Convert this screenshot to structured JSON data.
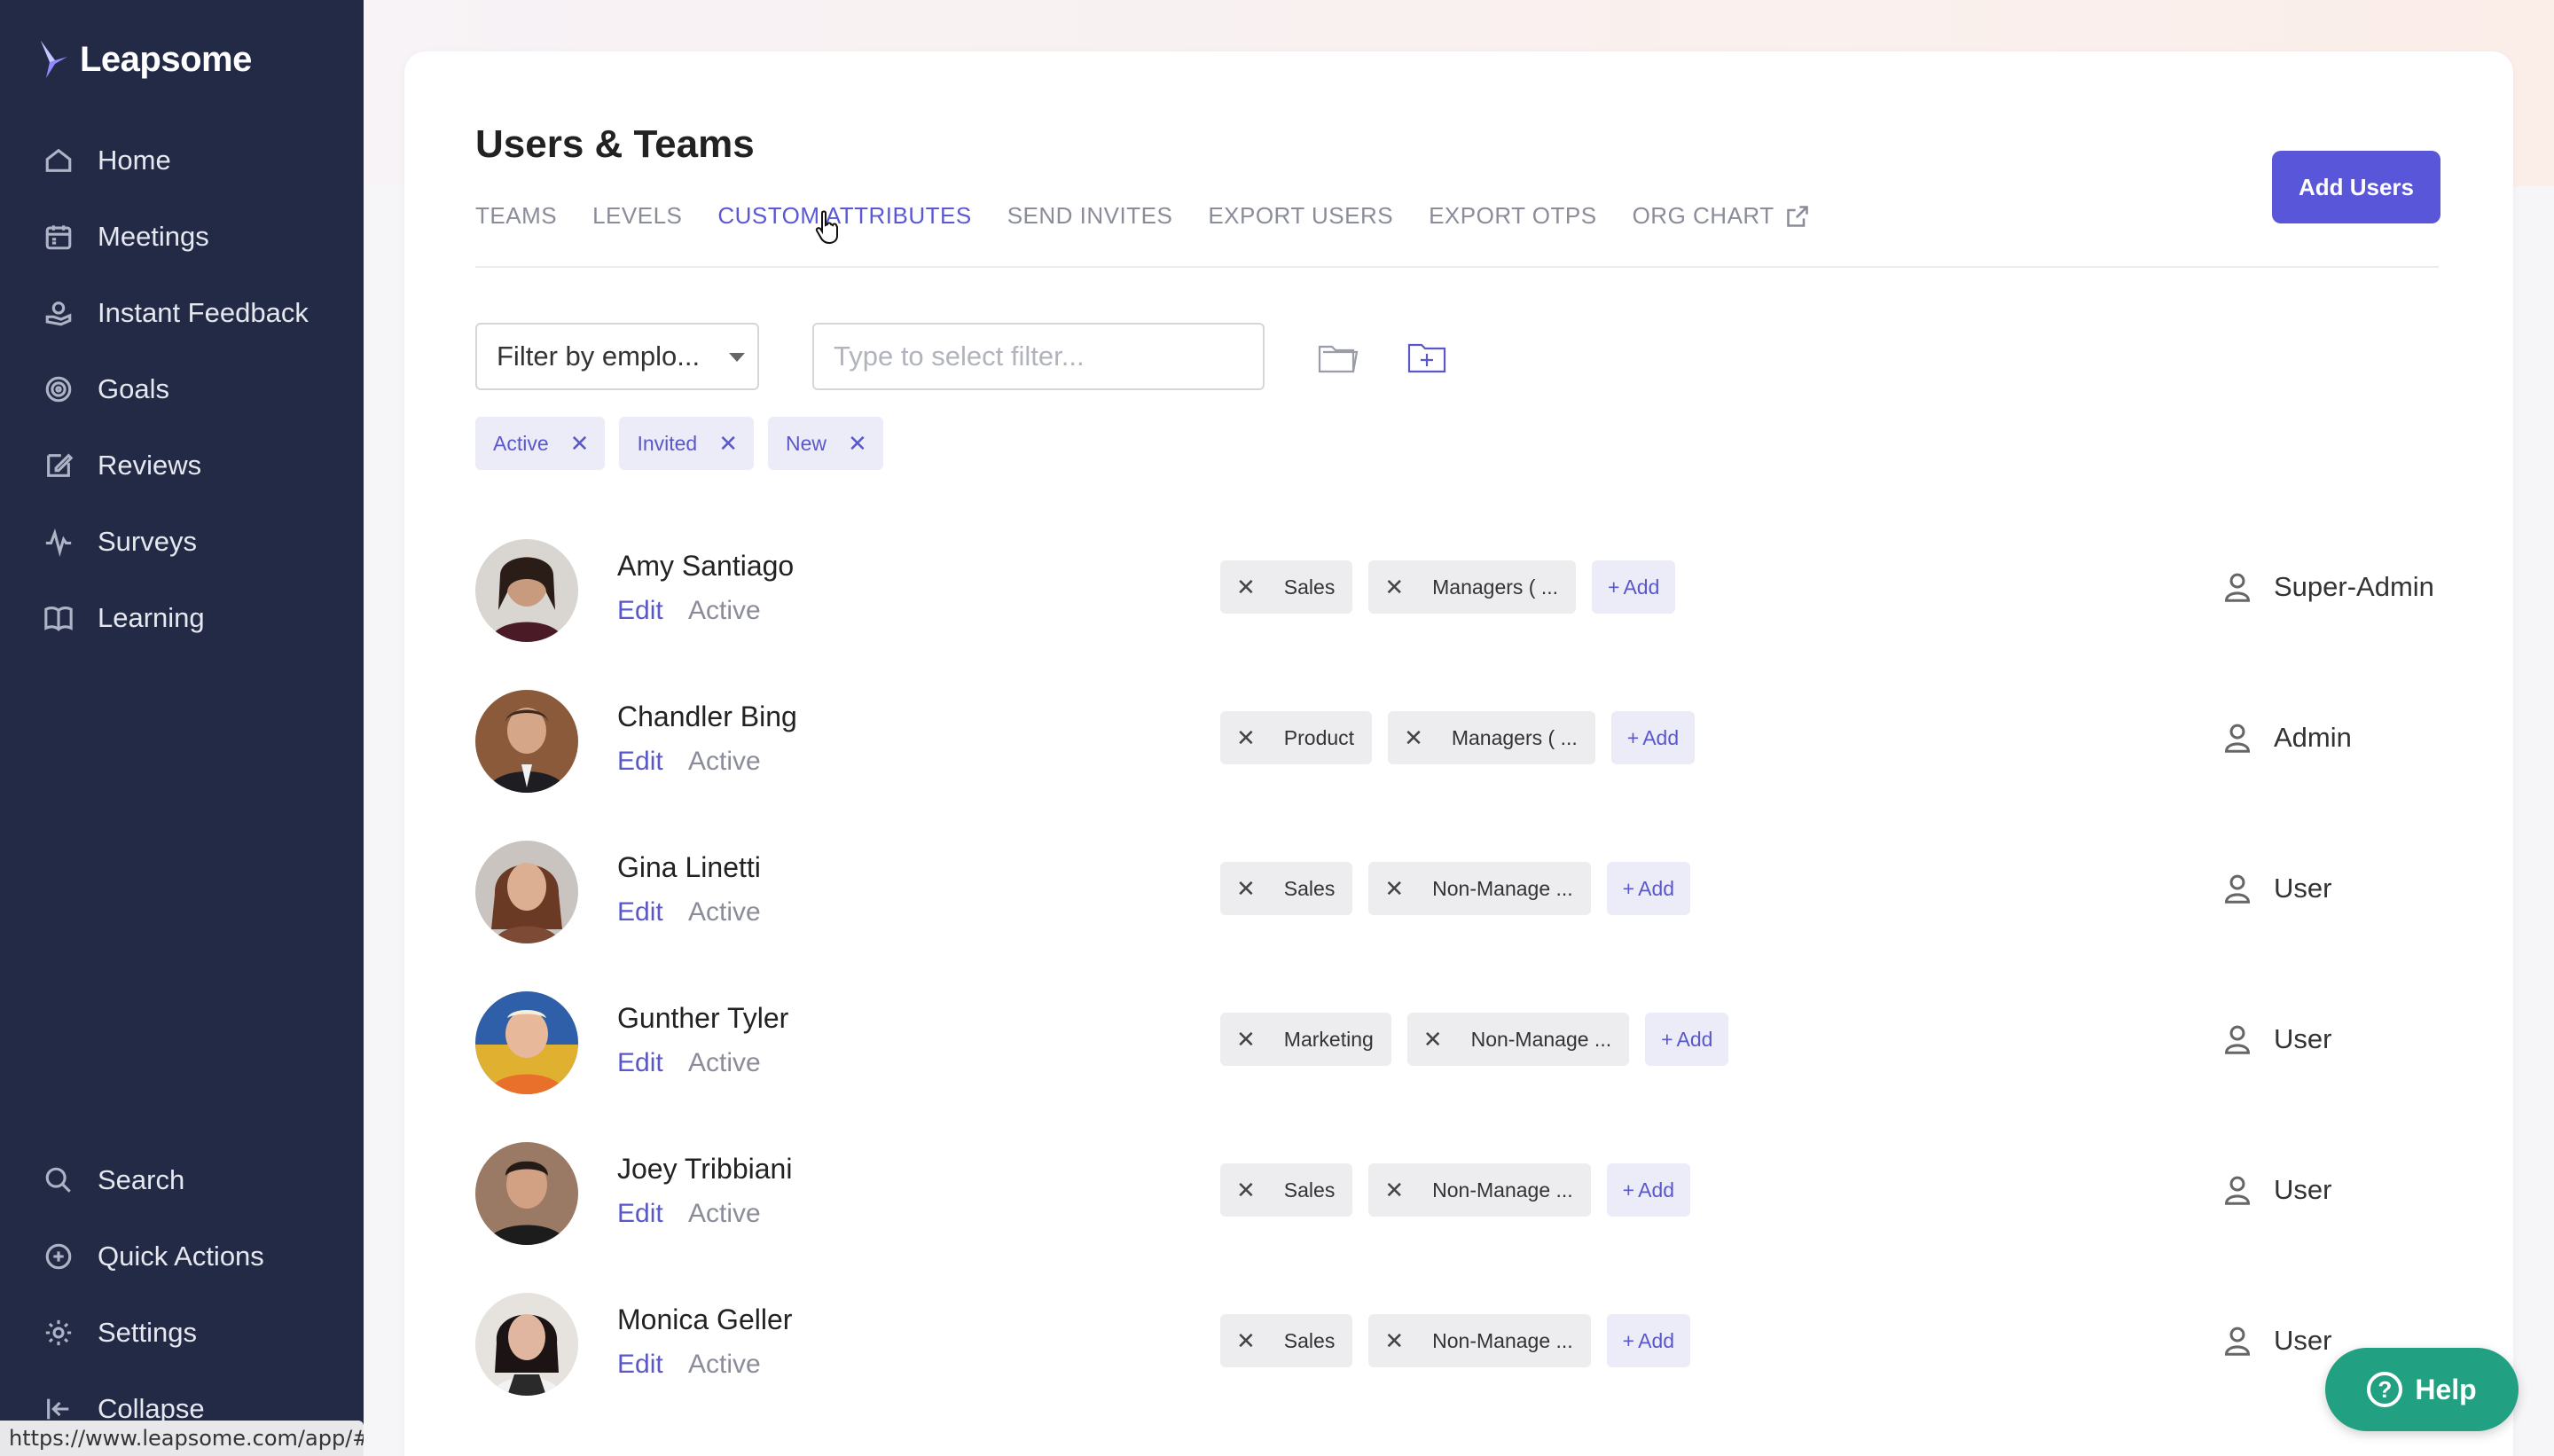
{
  "app": {
    "name": "Leapsome"
  },
  "nav": {
    "items": [
      {
        "label": "Home",
        "icon": "home-icon"
      },
      {
        "label": "Meetings",
        "icon": "calendar-icon"
      },
      {
        "label": "Instant Feedback",
        "icon": "hand-heart-icon"
      },
      {
        "label": "Goals",
        "icon": "target-icon"
      },
      {
        "label": "Reviews",
        "icon": "edit-icon"
      },
      {
        "label": "Surveys",
        "icon": "pulse-icon"
      },
      {
        "label": "Learning",
        "icon": "book-icon"
      }
    ],
    "bottom": [
      {
        "label": "Search",
        "icon": "search-icon"
      },
      {
        "label": "Quick Actions",
        "icon": "plus-circle-icon"
      },
      {
        "label": "Settings",
        "icon": "gear-icon"
      },
      {
        "label": "Collapse",
        "icon": "collapse-icon"
      }
    ]
  },
  "status_url": "https://www.leapsome.com/app/#",
  "page": {
    "title": "Users & Teams",
    "add_users_label": "Add Users",
    "tabs": [
      {
        "label": "TEAMS",
        "active": false
      },
      {
        "label": "LEVELS",
        "active": false
      },
      {
        "label": "CUSTOM ATTRIBUTES",
        "active": true
      },
      {
        "label": "SEND INVITES",
        "active": false
      },
      {
        "label": "EXPORT USERS",
        "active": false
      },
      {
        "label": "EXPORT OTPS",
        "active": false
      },
      {
        "label": "ORG CHART",
        "active": false
      }
    ],
    "filter_select_value": "Filter by emplo...",
    "filter_input_placeholder": "Type to select filter...",
    "status_chips": [
      "Active",
      "Invited",
      "New"
    ]
  },
  "users": [
    {
      "name": "Amy Santiago",
      "edit": "Edit",
      "status": "Active",
      "tags": [
        "Sales",
        "Managers ( ..."
      ],
      "add": "Add",
      "role": "Super-Admin"
    },
    {
      "name": "Chandler Bing",
      "edit": "Edit",
      "status": "Active",
      "tags": [
        "Product",
        "Managers ( ..."
      ],
      "add": "Add",
      "role": "Admin"
    },
    {
      "name": "Gina Linetti",
      "edit": "Edit",
      "status": "Active",
      "tags": [
        "Sales",
        "Non-Manage ..."
      ],
      "add": "Add",
      "role": "User"
    },
    {
      "name": "Gunther Tyler",
      "edit": "Edit",
      "status": "Active",
      "tags": [
        "Marketing",
        "Non-Manage ..."
      ],
      "add": "Add",
      "role": "User"
    },
    {
      "name": "Joey Tribbiani",
      "edit": "Edit",
      "status": "Active",
      "tags": [
        "Sales",
        "Non-Manage ..."
      ],
      "add": "Add",
      "role": "User"
    },
    {
      "name": "Monica Geller",
      "edit": "Edit",
      "status": "Active",
      "tags": [
        "Sales",
        "Non-Manage ..."
      ],
      "add": "Add",
      "role": "User"
    }
  ],
  "help_label": "Help",
  "colors": {
    "sidebar": "#232a45",
    "accent": "#5a56d9",
    "help": "#22a082"
  }
}
